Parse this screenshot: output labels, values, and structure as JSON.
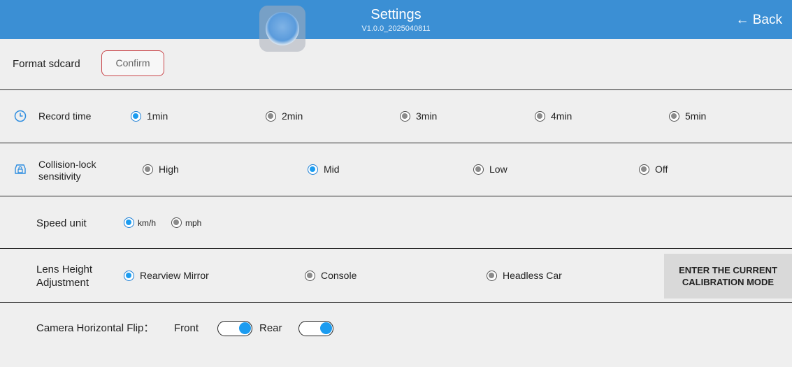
{
  "header": {
    "title": "Settings",
    "version": "V1.0.0_2025040811",
    "back_label": "← Back",
    "background_color": "#3b8fd4"
  },
  "format_sdcard": {
    "label": "Format sdcard",
    "confirm_label": "Confirm"
  },
  "record_time": {
    "label": "Record time",
    "icon": "clock-icon",
    "options": [
      "1min",
      "2min",
      "3min",
      "4min",
      "5min"
    ],
    "selected": "1min"
  },
  "collision_lock": {
    "label_line1": "Collision-lock",
    "label_line2": "sensitivity",
    "icon": "car-lock-icon",
    "options": [
      "High",
      "Mid",
      "Low",
      "Off"
    ],
    "selected": "Mid"
  },
  "speed_unit": {
    "label": "Speed unit",
    "options": [
      "km/h",
      "mph"
    ],
    "selected": "km/h"
  },
  "lens_height": {
    "label_line1": "Lens Height",
    "label_line2": "Adjustment",
    "options": [
      "Rearview Mirror",
      "Console",
      "Headless Car"
    ],
    "selected": "Rearview Mirror",
    "calibration_line1": "ENTER THE CURRENT",
    "calibration_line2": "CALIBRATION MODE"
  },
  "camera_flip": {
    "label": "Camera Horizontal Flip：",
    "front_label": "Front",
    "rear_label": "Rear",
    "front_on": true,
    "rear_on": true
  },
  "accent_color": "#1c9cf0",
  "confirm_border_color": "#c9464a"
}
